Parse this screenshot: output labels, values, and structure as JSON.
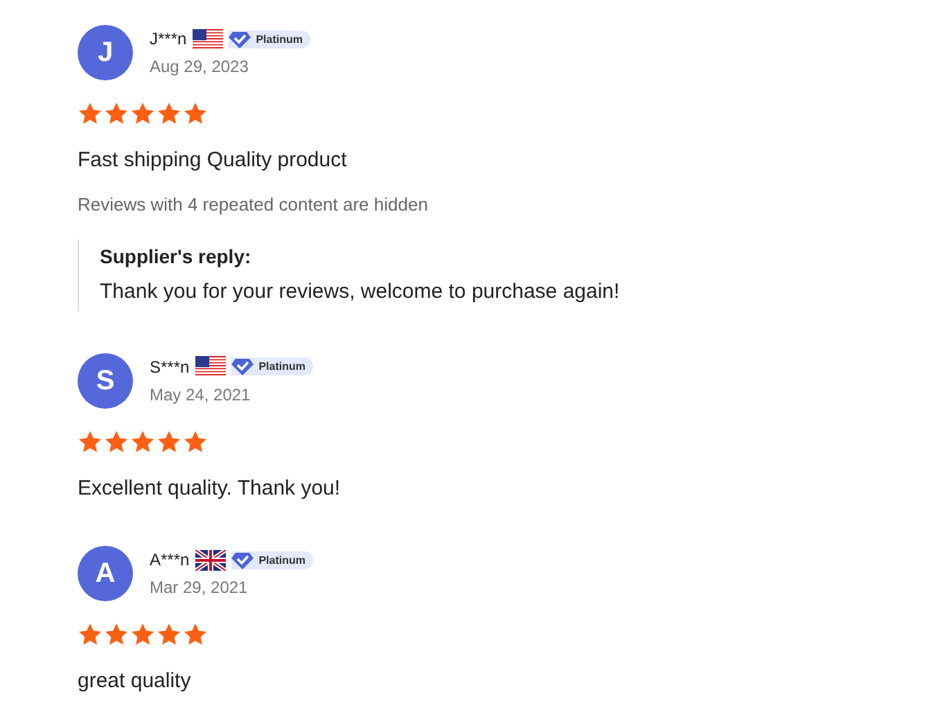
{
  "reviews": [
    {
      "initial": "J",
      "name": "J***n",
      "flag": {
        "kind": "us"
      },
      "badge": "Platinum",
      "date": "Aug 29, 2023",
      "stars": 5,
      "text": "Fast shipping Quality product",
      "hidden_note": "Reviews with 4 repeated content are hidden",
      "reply": {
        "title": "Supplier's reply:",
        "text": "Thank you for your reviews, welcome to purchase again!"
      }
    },
    {
      "initial": "S",
      "name": "S***n",
      "flag": {
        "kind": "us"
      },
      "badge": "Platinum",
      "date": "May 24, 2021",
      "stars": 5,
      "text": "Excellent quality. Thank you!"
    },
    {
      "initial": "A",
      "name": "A***n",
      "flag": {
        "kind": "gb"
      },
      "badge": "Platinum",
      "date": "Mar 29, 2021",
      "stars": 5,
      "text": "great quality"
    }
  ]
}
